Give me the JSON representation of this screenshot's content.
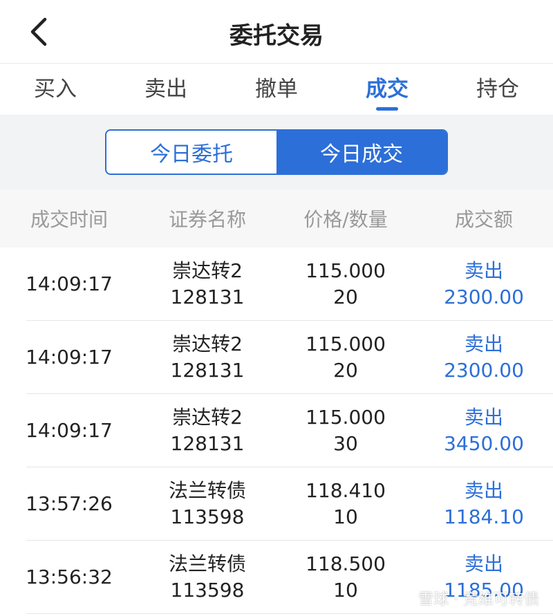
{
  "header": {
    "title": "委托交易"
  },
  "tabs": [
    {
      "label": "买入",
      "active": false
    },
    {
      "label": "卖出",
      "active": false
    },
    {
      "label": "撤单",
      "active": false
    },
    {
      "label": "成交",
      "active": true
    },
    {
      "label": "持仓",
      "active": false
    }
  ],
  "segment": {
    "left": "今日委托",
    "right": "今日成交"
  },
  "columns": {
    "time": "成交时间",
    "name": "证券名称",
    "price_qty": "价格/数量",
    "amount": "成交额"
  },
  "rows": [
    {
      "time": "14:09:17",
      "name": "崇达转2",
      "code": "128131",
      "price": "115.000",
      "qty": "20",
      "side": "卖出",
      "amount": "2300.00"
    },
    {
      "time": "14:09:17",
      "name": "崇达转2",
      "code": "128131",
      "price": "115.000",
      "qty": "20",
      "side": "卖出",
      "amount": "2300.00"
    },
    {
      "time": "14:09:17",
      "name": "崇达转2",
      "code": "128131",
      "price": "115.000",
      "qty": "30",
      "side": "卖出",
      "amount": "3450.00"
    },
    {
      "time": "13:57:26",
      "name": "法兰转债",
      "code": "113598",
      "price": "118.410",
      "qty": "10",
      "side": "卖出",
      "amount": "1184.10"
    },
    {
      "time": "13:56:32",
      "name": "法兰转债",
      "code": "113598",
      "price": "118.500",
      "qty": "10",
      "side": "卖出",
      "amount": "1185.00"
    }
  ],
  "watermark": "雪球 · 竞维可转债",
  "colors": {
    "accent": "#2c6fd8",
    "muted": "#999999",
    "band": "#f2f3f5"
  }
}
